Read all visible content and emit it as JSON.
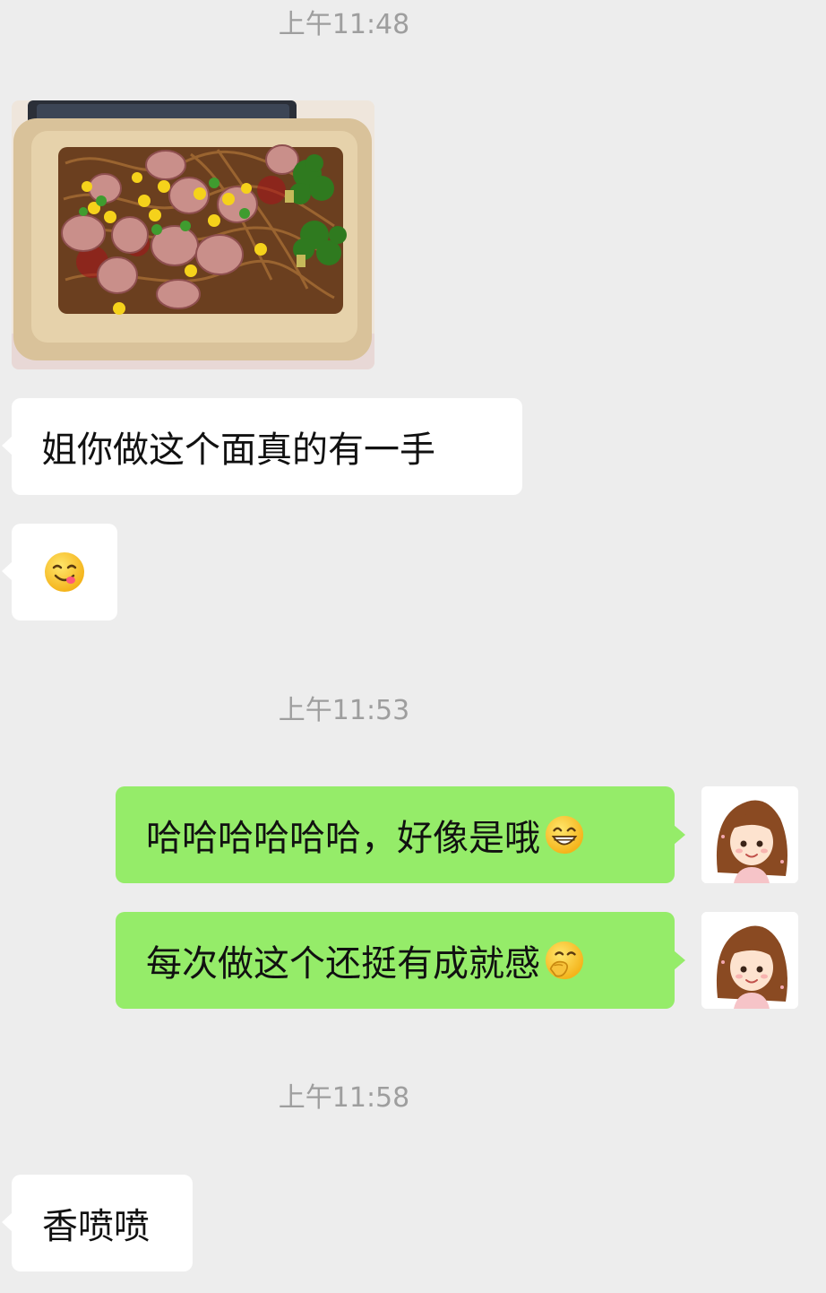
{
  "messages": [
    {
      "type": "time",
      "text": "上午11:48"
    },
    {
      "type": "image",
      "side": "left",
      "icon": "noodle-dish-photo"
    },
    {
      "type": "text",
      "side": "left",
      "text": "姐你做这个面真的有一手"
    },
    {
      "type": "emoji",
      "side": "left",
      "icon": "yum-face-emoji"
    },
    {
      "type": "time",
      "text": "上午11:53"
    },
    {
      "type": "text",
      "side": "right",
      "text": "哈哈哈哈哈哈，好像是哦",
      "icon": "grinning-face-emoji"
    },
    {
      "type": "text",
      "side": "right",
      "text": "每次做这个还挺有成就感",
      "icon": "shy-hand-face-emoji"
    },
    {
      "type": "time",
      "text": "上午11:58"
    },
    {
      "type": "text",
      "side": "left",
      "text": "香喷喷"
    }
  ],
  "colors": {
    "background": "#ededed",
    "left_bubble": "#ffffff",
    "right_bubble": "#95ec69",
    "timestamp": "#9e9e9e"
  }
}
